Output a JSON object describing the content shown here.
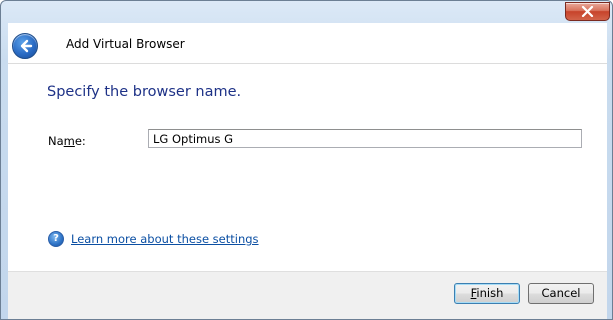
{
  "window": {
    "title": "Add Virtual Browser",
    "close_label": "×"
  },
  "main": {
    "instruction": "Specify the browser name.",
    "name_label_pre": "Na",
    "name_label_underlined": "m",
    "name_label_post": "e:",
    "name_value": "LG Optimus G",
    "help_icon_glyph": "?",
    "help_link": "Learn more about these settings"
  },
  "footer": {
    "finish_label_underlined": "F",
    "finish_label_rest": "inish",
    "cancel_label": "Cancel"
  },
  "colors": {
    "instruction": "#1e3287",
    "link": "#0b4fa3",
    "close_button": "#c7432a",
    "back_button": "#2a6bc4"
  },
  "icons": {
    "back": "back-arrow-icon",
    "close": "close-icon",
    "help": "help-icon"
  }
}
